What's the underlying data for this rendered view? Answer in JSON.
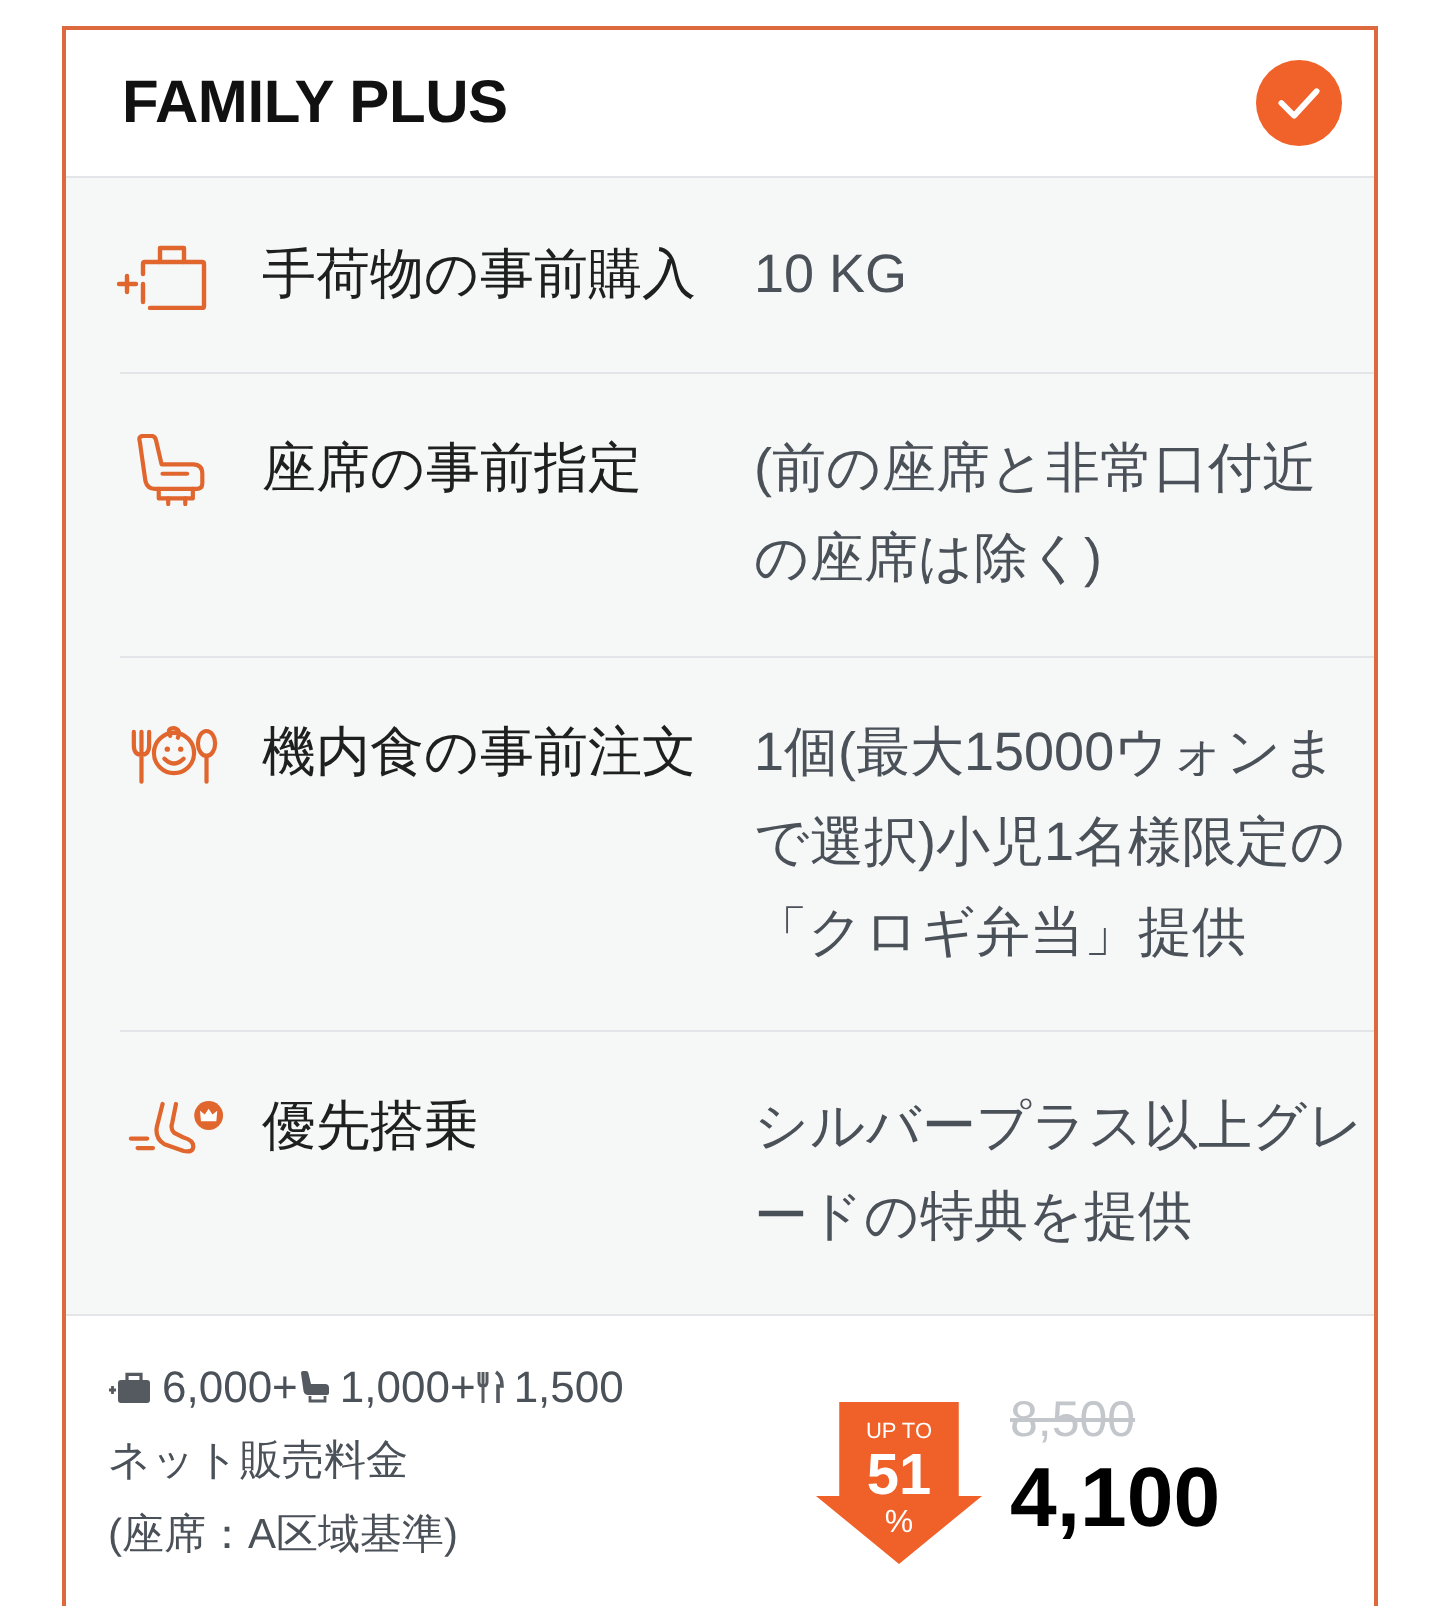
{
  "plan": {
    "title": "FAMILY PLUS",
    "selected": true
  },
  "benefits": [
    {
      "kind": "baggage",
      "label": "手荷物の事前購入",
      "value": "10 KG"
    },
    {
      "kind": "seat",
      "label": "座席の事前指定",
      "value": "(前の座席と非常口付近の座席は除く)"
    },
    {
      "kind": "meal",
      "label": "機内食の事前注文",
      "value": "1個(最大15000ウォンまで選択)小児1名様限定の「クロギ弁当」提供"
    },
    {
      "kind": "boarding",
      "label": "優先搭乗",
      "value": "シルバープラス以上グレードの特典を提供"
    }
  ],
  "price": {
    "breakdown": [
      {
        "kind": "baggage",
        "amount": "6,000+"
      },
      {
        "kind": "seat",
        "amount": "1,000+"
      },
      {
        "kind": "meal",
        "amount": "1,500"
      }
    ],
    "label": "ネット販売料金",
    "note": "(座席：A区域基準)",
    "discount": {
      "prefix": "UP TO",
      "value": "51",
      "unit": "%"
    },
    "original": "8,500",
    "final": "4,100"
  }
}
